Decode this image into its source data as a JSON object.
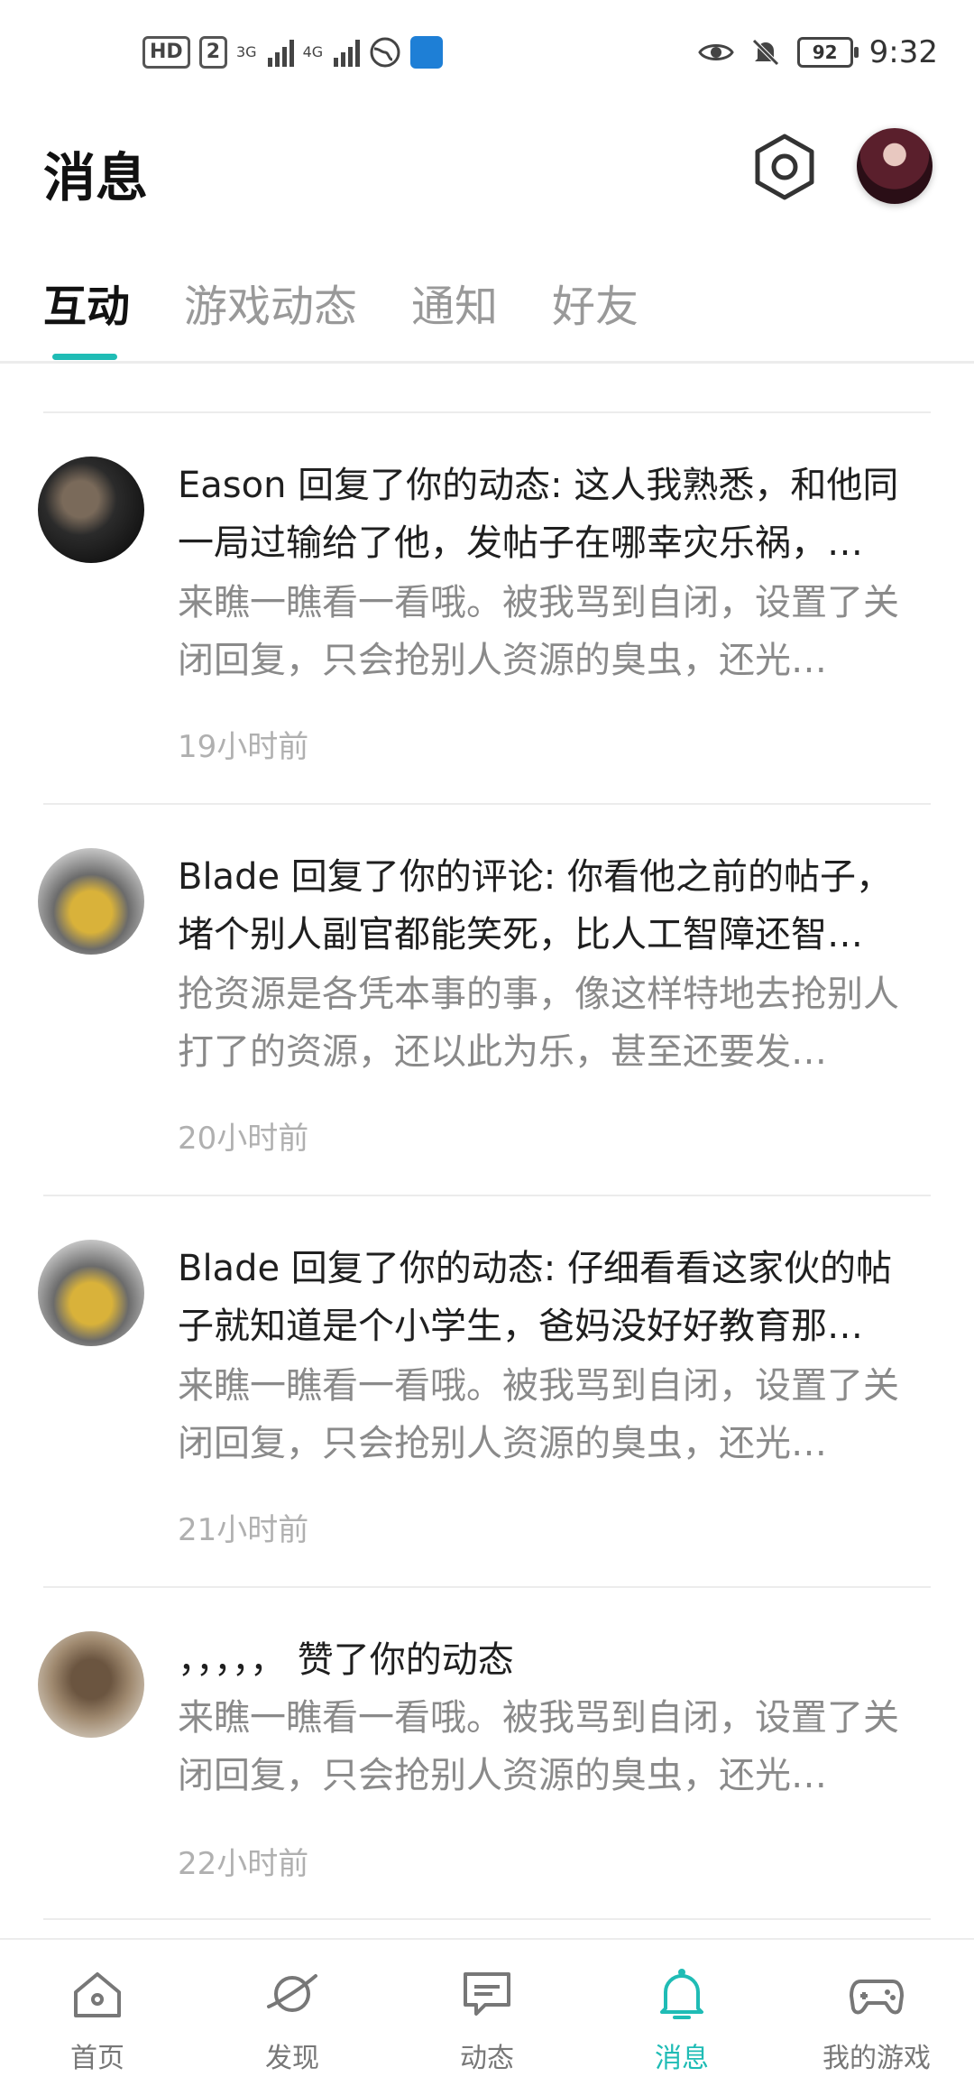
{
  "status_bar": {
    "hd": "HD",
    "sim": "2",
    "net1": "3G",
    "net2": "4G",
    "battery": "92",
    "time": "9:32"
  },
  "header": {
    "title": "消息"
  },
  "tabs": [
    {
      "label": "互动",
      "active": true
    },
    {
      "label": "游戏动态",
      "active": false
    },
    {
      "label": "通知",
      "active": false
    },
    {
      "label": "好友",
      "active": false
    }
  ],
  "messages": [
    {
      "title": "Eason 回复了你的动态: 这人我熟悉，和他同一局过输给了他，发帖子在哪幸灾乐祸，…",
      "quote": "来瞧一瞧看一看哦。被我骂到自闭，设置了关闭回复，只会抢别人资源的臭虫，还光…",
      "time": "19小时前"
    },
    {
      "title": "Blade 回复了你的评论: 你看他之前的帖子，堵个别人副官都能笑死，比人工智障还智…",
      "quote": "抢资源是各凭本事的事，像这样特地去抢别人打了的资源，还以此为乐，甚至还要发…",
      "time": "20小时前"
    },
    {
      "title": "Blade 回复了你的动态: 仔细看看这家伙的帖子就知道是个小学生，爸妈没好好教育那…",
      "quote": "来瞧一瞧看一看哦。被我骂到自闭，设置了关闭回复，只会抢别人资源的臭虫，还光…",
      "time": "21小时前"
    },
    {
      "title": "，，，，，  赞了你的动态",
      "quote": "来瞧一瞧看一看哦。被我骂到自闭，设置了关闭回复，只会抢别人资源的臭虫，还光…",
      "time": "22小时前"
    }
  ],
  "bottom_nav": [
    {
      "label": "首页",
      "icon": "home-icon"
    },
    {
      "label": "发现",
      "icon": "planet-icon"
    },
    {
      "label": "动态",
      "icon": "chat-icon"
    },
    {
      "label": "消息",
      "icon": "bell-icon",
      "active": true
    },
    {
      "label": "我的游戏",
      "icon": "gamepad-icon"
    }
  ],
  "colors": {
    "accent": "#1fbcb5"
  }
}
